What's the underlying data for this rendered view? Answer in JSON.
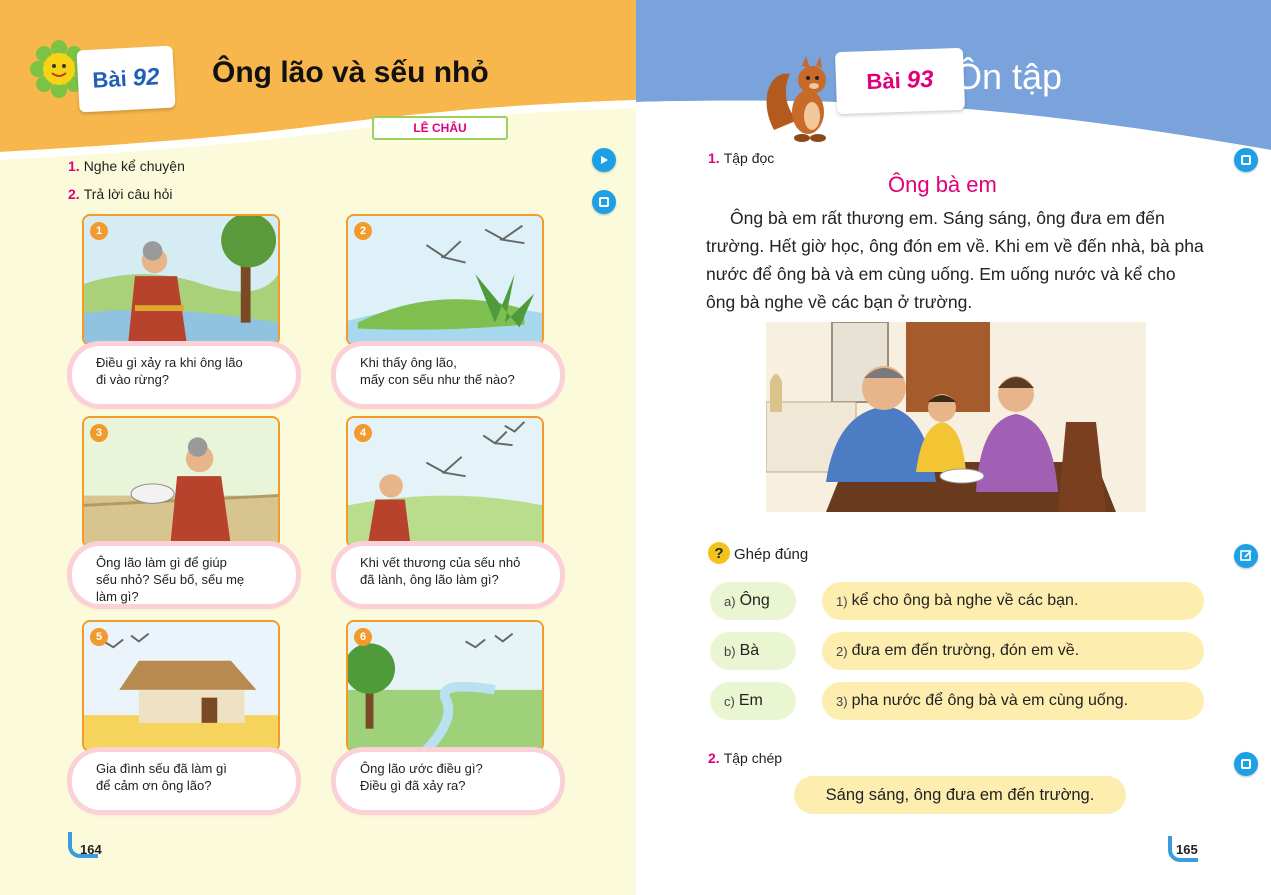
{
  "left_page": {
    "lesson_label": "Bài",
    "lesson_number": "92",
    "title": "Ông lão và sếu nhỏ",
    "author": "LÊ CHÂU",
    "sections": [
      {
        "number": "1.",
        "label": "Nghe kể chuyện"
      },
      {
        "number": "2.",
        "label": "Trả lời câu hỏi"
      }
    ],
    "panels": [
      {
        "number": "1",
        "question": "Điều gì xảy ra khi ông lão\nđi vào rừng?"
      },
      {
        "number": "2",
        "question": "Khi thấy ông lão,\nmấy con sếu như thế nào?"
      },
      {
        "number": "3",
        "question": "Ông lão làm gì để giúp\nsếu nhỏ? Sếu bố, sếu mẹ\nlàm gì?"
      },
      {
        "number": "4",
        "question": "Khi vết thương của sếu nhỏ\nđã lành, ông lão làm gì?"
      },
      {
        "number": "5",
        "question": "Gia đình sếu đã làm gì\nđể cảm ơn ông lão?"
      },
      {
        "number": "6",
        "question": "Ông lão ước điều gì?\nĐiều gì đã xảy ra?"
      }
    ],
    "page_number": "164"
  },
  "right_page": {
    "lesson_label": "Bài",
    "lesson_number": "93",
    "title": "Ôn tập",
    "section1": {
      "number": "1.",
      "label": "Tập đọc"
    },
    "reading_title": "Ông bà em",
    "reading_text": "Ông bà em rất thương em. Sáng sáng, ông đưa em đến trường. Hết giờ học, ông đón em về. Khi em về đến nhà, bà pha nước để ông bà và em cùng uống. Em uống nước và kể cho ông bà nghe về các bạn ở trường.",
    "matching_label": "Ghép đúng",
    "question_mark": "?",
    "match_left": [
      {
        "key": "a)",
        "text": "Ông"
      },
      {
        "key": "b)",
        "text": "Bà"
      },
      {
        "key": "c)",
        "text": "Em"
      }
    ],
    "match_right": [
      {
        "key": "1)",
        "text": "kể cho ông bà nghe về các bạn."
      },
      {
        "key": "2)",
        "text": "đưa em đến trường, đón em về."
      },
      {
        "key": "3)",
        "text": "pha nước để ông bà và em cùng uống."
      }
    ],
    "section2": {
      "number": "2.",
      "label": "Tập chép"
    },
    "copy_sentence": "Sáng sáng, ông đưa em đến trường.",
    "page_number": "165"
  },
  "colors": {
    "left_header": "#f7b74c",
    "right_header": "#7aa3dc",
    "accent_pink": "#e0007a",
    "button_blue": "#1ea0e6",
    "panel_border": "#f39a2c"
  },
  "icons": [
    "sun-flower-logo-icon",
    "squirrel-mascot-icon",
    "audio-play-icon",
    "book-icon",
    "edit-icon",
    "question-icon",
    "page-corner-icon"
  ]
}
